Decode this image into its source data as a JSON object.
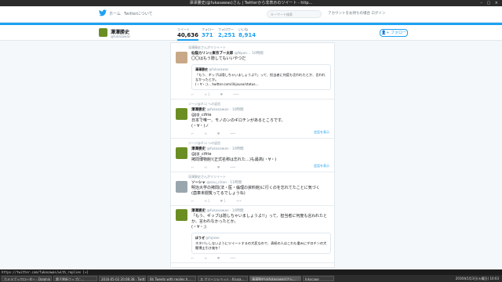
{
  "window": {
    "title": "澤澤勝史(@fukasawas)さん | Twitterから非表示のツイート - http...",
    "controls": "– ▢ ×"
  },
  "topnav": {
    "home": "ホーム",
    "about": "Twitterについて",
    "search_placeholder": "キーワード検索",
    "login_text": "アカウントをお持ちの場合 ログイン"
  },
  "profile": {
    "name": "澤澤勝史",
    "handle": "@fukasawas",
    "stats": [
      {
        "label": "ツイート",
        "value": "40,636"
      },
      {
        "label": "フォロー",
        "value": "371"
      },
      {
        "label": "フォロワー",
        "value": "2,251"
      },
      {
        "label": "いいね",
        "value": "8,914"
      }
    ],
    "follow_label": "フォロー"
  },
  "tweets": [
    {
      "context": "深澤勝史さんがリツイート",
      "name": "仙猫カリン◎東京ブー太郎",
      "handle": "@Nyan…",
      "time": "10時間",
      "body": "〇〇はもう隠してもいいやつだ",
      "avatar_color": "#c8a887",
      "quote": {
        "name": "澤澤勝史",
        "handle": "@fukasawas",
        "body": "「もう、ギッブは隠しちゃいましょうよ!!」って、担当者に何度も言われたとか、言われなかったとか。\n(・∀・;)… twitter.com/i/kjsuse/status…"
      },
      "actions": [
        "↩",
        "⟲ 1",
        "♥",
        "•••"
      ]
    },
    {
      "context": "ジージ@ネコ への返信",
      "name": "澤澤勝史",
      "handle": "@fukasawas · 10時間",
      "time": "",
      "body": "@jiji_cifrie\n日本で唯一、モノのンのギロチンがあるところです。\n(・∀・)ノ",
      "avatar_color": "#6b8e23",
      "quote": null,
      "actions": [
        "↩",
        "⟲",
        "♥",
        "•••"
      ],
      "more": "会話を表示"
    },
    {
      "context": "ジージ@ネコ への返信",
      "name": "澤澤勝史",
      "handle": "@fukasawas · 10時間",
      "time": "",
      "body": "@jiji_cifrie\n拷問博物館!(正式名称は忘れた…)も最高(・∀・)",
      "avatar_color": "#6b8e23",
      "quote": null,
      "actions": [
        "↩",
        "⟲",
        "♥",
        "•••"
      ],
      "more": "会話を表示"
    },
    {
      "context": "深澤勝史さんがリツイート",
      "name": "ソーシャ",
      "handle": "@sou_chan · 11時間",
      "time": "",
      "body": "明治大学の拷問(法・医・倫理の資料館)に行くのを忘れてたことに気づく\n(歯車未閲覧ってるでしょうね)",
      "avatar_color": "#9aa6ad",
      "quote": null,
      "actions": [
        "↩",
        "⟲ 1",
        "♥ 1",
        "•••"
      ]
    },
    {
      "context": "",
      "name": "澤澤勝史",
      "handle": "@fukasawas · 10時間",
      "time": "",
      "body": "「もう、ギッブは隠しちゃいましょうよ!!」って、担当者に何度も言われたとか、言われなかったとか。\n(・∀・;)",
      "avatar_color": "#6b8e23",
      "quote": {
        "name": "ぼうぜ",
        "handle": "@fujiexe",
        "body": "ネタバレしないようにツイートするの大変なので、表紙の人はこれも重みにギロチンの大閣博士引き後を!"
      },
      "actions": [
        "↩",
        "⟲",
        "♥",
        "•••"
      ]
    }
  ],
  "statusbar": {
    "url": "https://twitter.com/fukasawas/with_replies [+]"
  },
  "taskbar": {
    "tasks": [
      "カメラブックローダー - Dolphin",
      "電子黒板ウェブに…",
      "2016-05-02 20:08:38 - Twitter",
      "6ti Tweets with replies h…",
      "ス クリーンショット - Krusa…",
      "澤澤勝史(@fukasawas)さん…",
      "Inkscape"
    ],
    "clock": "2016年5月3日(火曜日) 10:03"
  }
}
